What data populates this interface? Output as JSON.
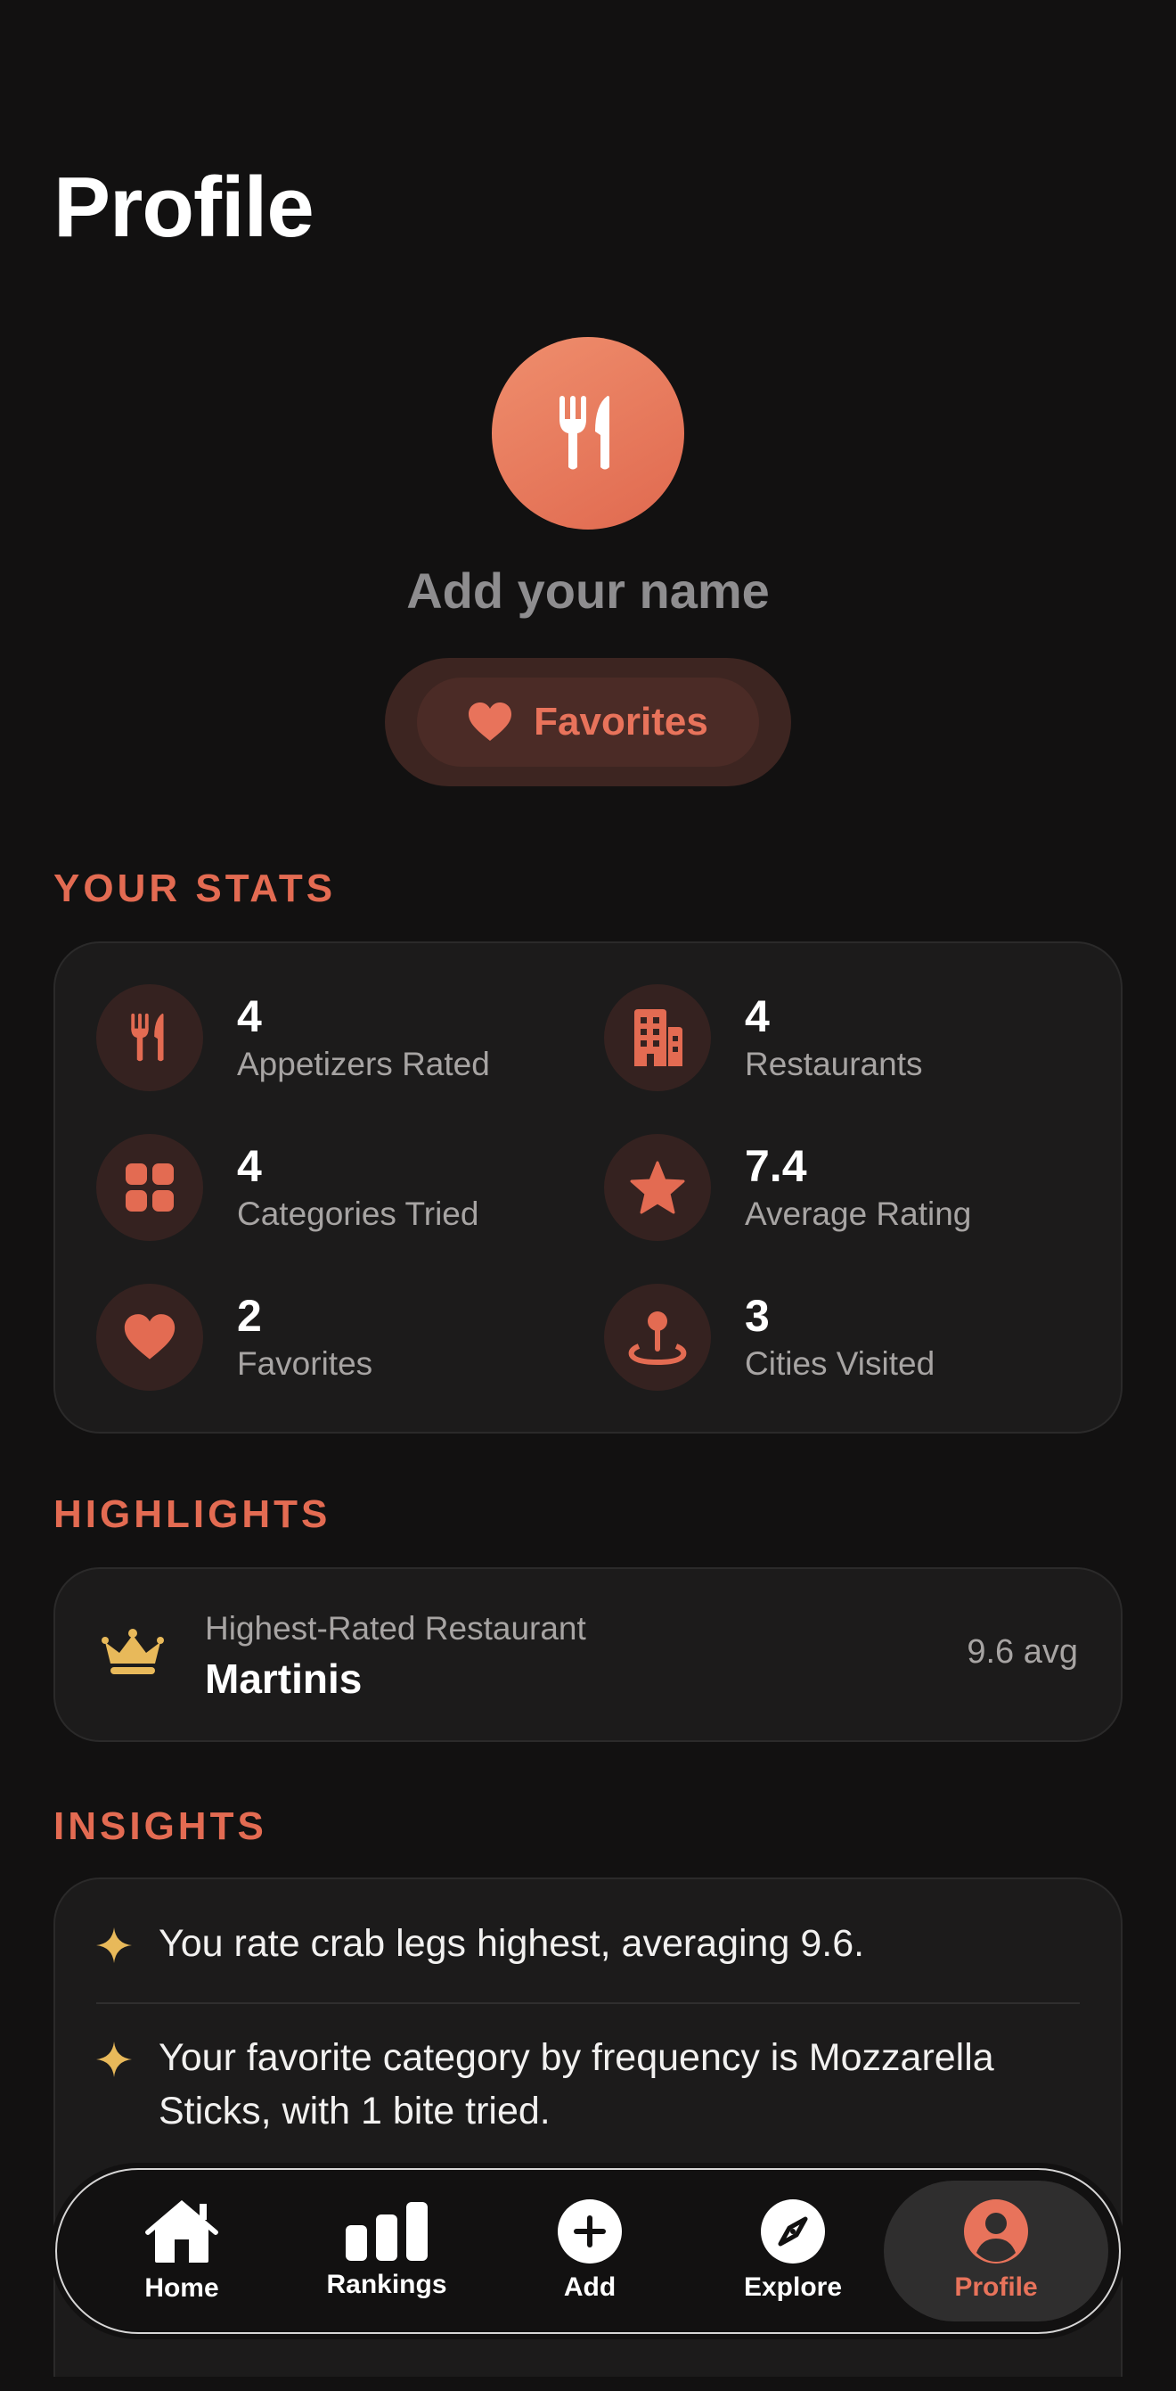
{
  "header": {
    "title": "Profile"
  },
  "profile": {
    "name_placeholder": "Add your name",
    "favorites_button": "Favorites"
  },
  "stats": {
    "heading": "YOUR STATS",
    "items": [
      {
        "icon": "fork-knife-icon",
        "value": "4",
        "label": "Appetizers Rated"
      },
      {
        "icon": "building-icon",
        "value": "4",
        "label": "Restaurants"
      },
      {
        "icon": "grid-icon",
        "value": "4",
        "label": "Categories Tried"
      },
      {
        "icon": "star-icon",
        "value": "7.4",
        "label": "Average Rating"
      },
      {
        "icon": "heart-icon",
        "value": "2",
        "label": "Favorites"
      },
      {
        "icon": "map-pin-icon",
        "value": "3",
        "label": "Cities Visited"
      }
    ]
  },
  "highlights": {
    "heading": "HIGHLIGHTS",
    "caption": "Highest-Rated Restaurant",
    "name": "Martinis",
    "score": "9.6 avg"
  },
  "insights": {
    "heading": "INSIGHTS",
    "items": [
      "You rate crab legs highest, averaging 9.6.",
      "Your favorite category by frequency is Mozzarella Sticks, with 1 bite tried."
    ]
  },
  "tabs": [
    {
      "label": "Home",
      "icon": "house-icon"
    },
    {
      "label": "Rankings",
      "icon": "bar-chart-icon"
    },
    {
      "label": "Add",
      "icon": "plus-circle-icon"
    },
    {
      "label": "Explore",
      "icon": "compass-icon"
    },
    {
      "label": "Profile",
      "icon": "person-circle-icon",
      "active": true
    }
  ],
  "colors": {
    "accent": "#e8735b",
    "background": "#121111",
    "card": "#1c1b1b",
    "gold": "#e8b95a"
  }
}
